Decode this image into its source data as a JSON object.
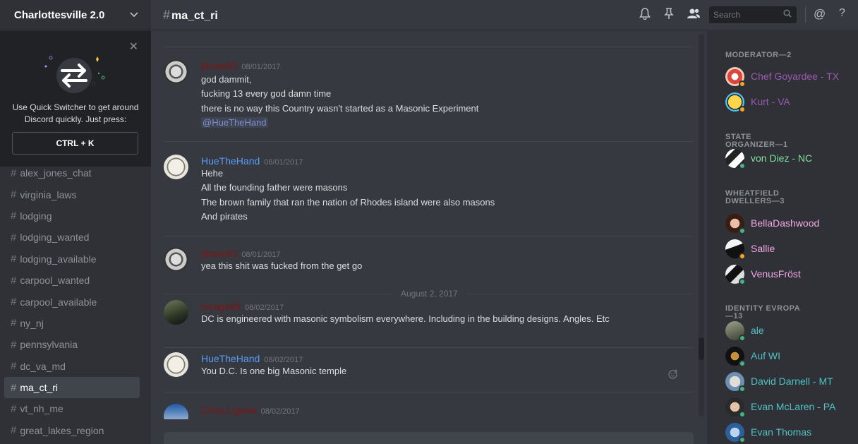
{
  "guild": {
    "name": "Charlottesville 2.0"
  },
  "quick_switcher": {
    "text": "Use Quick Switcher to get around Discord quickly. Just press:",
    "shortcut": "CTRL + K"
  },
  "channels": [
    {
      "name": "alex_jones_chat"
    },
    {
      "name": "virginia_laws"
    },
    {
      "name": "lodging"
    },
    {
      "name": "lodging_wanted"
    },
    {
      "name": "lodging_available"
    },
    {
      "name": "carpool_wanted"
    },
    {
      "name": "carpool_available"
    },
    {
      "name": "ny_nj"
    },
    {
      "name": "pennsylvania"
    },
    {
      "name": "dc_va_md"
    },
    {
      "name": "ma_ct_ri",
      "active": true
    },
    {
      "name": "vt_nh_me"
    },
    {
      "name": "great_lakes_region"
    }
  ],
  "channel_title": "ma_ct_ri",
  "hash_symbol": "#",
  "search": {
    "placeholder": "Search"
  },
  "toolbar": {
    "mention_symbol": "@",
    "help_symbol": "?"
  },
  "date_divider": "August 2, 2017",
  "messages": [
    {
      "author": "jtlowe83",
      "author_color": "#7d1515",
      "timestamp": "08/01/2017",
      "lines": [
        "god dammit,",
        "fucking 13 every god damn time",
        "there is no way this Country wasn't started as a Masonic Experiment"
      ],
      "mention": "@HueTheHand"
    },
    {
      "author": "HueTheHand",
      "author_color": "#5a9bf5",
      "timestamp": "08/01/2017",
      "lines": [
        "Hehe",
        "All the founding father were masons",
        "The brown family that ran the nation of Rhodes island were also masons",
        "And pirates"
      ]
    },
    {
      "author": "jtlowe83",
      "author_color": "#7d1515",
      "timestamp": "08/01/2017",
      "lines": [
        "yea this shit was fucked from the get go"
      ]
    },
    {
      "author": "tscags88",
      "author_color": "#7d1515",
      "timestamp": "08/02/2017",
      "lines": [
        "DC is engineered with masonic symbolism everywhere. Including in the building designs. Angles. Etc"
      ]
    },
    {
      "author": "HueTheHand",
      "author_color": "#5a9bf5",
      "timestamp": "08/02/2017",
      "lines": [
        "You D.C. Is one big Masonic temple"
      ]
    },
    {
      "author": "Chris Liguria",
      "author_color": "#7d1515",
      "timestamp": "08/02/2017",
      "lines": []
    }
  ],
  "member_groups": [
    {
      "title": "MODERATOR—2",
      "members": [
        {
          "name": "Chef Goyardee - TX",
          "color": "#9b59b6",
          "status": "#faa61a"
        },
        {
          "name": "Kurt - VA",
          "color": "#9b59b6",
          "status": "#faa61a"
        }
      ]
    },
    {
      "title": "STATE ORGANIZER—1",
      "members": [
        {
          "name": "von Diez - NC",
          "color": "#7ee0a0",
          "status": "#43b581"
        }
      ]
    },
    {
      "title": "WHEATFIELD DWELLERS—3",
      "members": [
        {
          "name": "BellaDashwood",
          "color": "#f0a8e6",
          "status": "#43b581"
        },
        {
          "name": "Sallie",
          "color": "#f0a8e6",
          "status": "#faa61a"
        },
        {
          "name": "VenusFröst",
          "color": "#f0a8e6",
          "status": "#43b581"
        }
      ]
    },
    {
      "title": "IDENTITY EVROPA—13",
      "members": [
        {
          "name": "ale",
          "color": "#4fc3c6",
          "status": "#43b581"
        },
        {
          "name": "Auf WI",
          "color": "#4fc3c6",
          "status": "#43b581"
        },
        {
          "name": "David Darnell - MT",
          "color": "#4fc3c6",
          "status": "#43b581"
        },
        {
          "name": "Evan McLaren - PA",
          "color": "#4fc3c6",
          "status": "#43b581"
        },
        {
          "name": "Evan Thomas",
          "color": "#4fc3c6",
          "status": "#43b581"
        }
      ]
    }
  ],
  "icons": [
    "chevron-down-icon",
    "close-icon",
    "bell-icon",
    "pin-icon",
    "members-icon",
    "search-icon",
    "add-reaction-icon"
  ]
}
